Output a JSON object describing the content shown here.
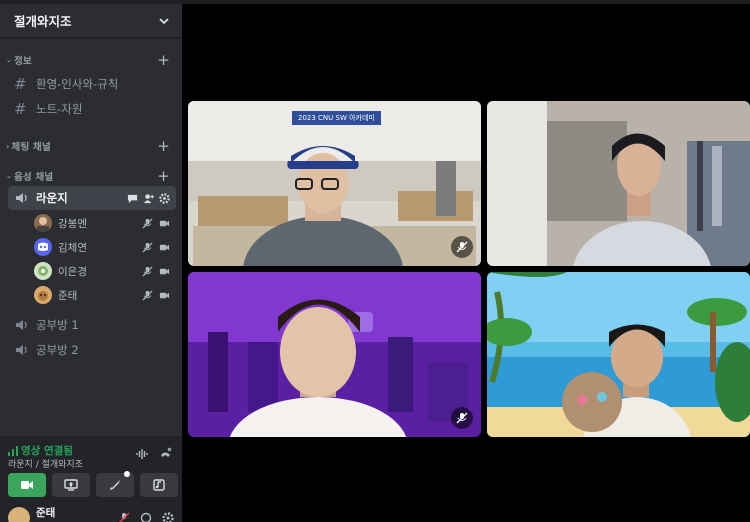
{
  "server": {
    "name": "절개와지조"
  },
  "categories": {
    "info": "정보",
    "chat": "체팅 채널",
    "voice": "음성 채널"
  },
  "text_channels": [
    {
      "name": "환영-인사와-규칙"
    },
    {
      "name": "노트-자원"
    }
  ],
  "voice_channels": [
    {
      "name": "라운지",
      "active": true
    },
    {
      "name": "공부방 1"
    },
    {
      "name": "공부방 2"
    }
  ],
  "voice_users": [
    {
      "name": "강봉멘",
      "avatar_color": "#8a6b4f"
    },
    {
      "name": "김체연",
      "avatar_color": "#5865f2"
    },
    {
      "name": "이은경",
      "avatar_color": "#cfe3c2"
    },
    {
      "name": "준태",
      "avatar_color": "#d9a86b"
    }
  ],
  "voice_status": {
    "status": "영상 연결됨",
    "location": "라운지 / 절개와지조"
  },
  "current_user": {
    "name": "준태"
  },
  "video_tiles": [
    {
      "banner": "2023 CNU SW 아카데미",
      "muted": true
    },
    {
      "muted": false
    },
    {
      "muted": true
    },
    {
      "muted": false
    }
  ],
  "colors": {
    "connected": "#23a55a",
    "sidebar_bg": "#2b2d31",
    "active_channel_bg": "#404249"
  }
}
